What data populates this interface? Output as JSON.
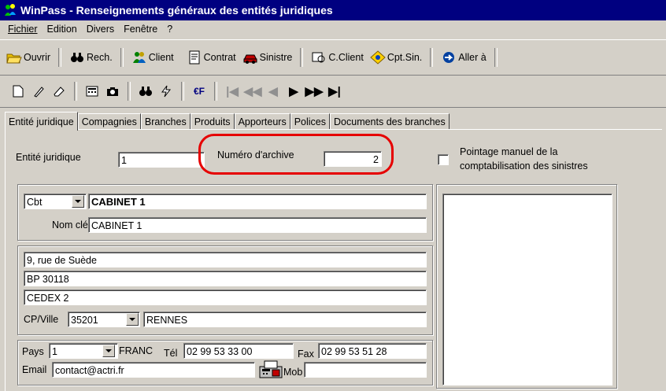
{
  "window": {
    "title": "WinPass - Renseignements généraux des entités juridiques",
    "app_icon": "winpass-people-icon"
  },
  "menu": {
    "items": [
      "Fichier",
      "Edition",
      "Divers",
      "Fenêtre",
      "?"
    ]
  },
  "toolbar1": {
    "open": "Ouvrir",
    "search": "Rech.",
    "client": "Client",
    "contract": "Contrat",
    "claim": "Sinistre",
    "client_account": "C.Client",
    "claim_account": "Cpt.Sin.",
    "goto": "Aller à"
  },
  "toolbar2": {
    "icons": [
      "new-document-icon",
      "edit-pencil-icon",
      "eraser-icon",
      "calculator-icon",
      "camera-icon",
      "binoculars-icon",
      "lightning-icon",
      "euro-franc-icon",
      "first-record-icon",
      "rewind-icon",
      "previous-icon",
      "next-icon",
      "fast-forward-icon",
      "last-record-icon"
    ],
    "euro_label": "€F"
  },
  "tabs": [
    "Entité juridique",
    "Compagnies",
    "Branches",
    "Produits",
    "Apporteurs",
    "Polices",
    "Documents des branches"
  ],
  "form": {
    "entity_label": "Entité juridique",
    "entity_value": "1",
    "archive_label": "Numéro d'archive",
    "archive_value": "2",
    "manual_label_1": "Pointage manuel de la",
    "manual_label_2": "comptabilisation des sinistres",
    "type_value": "Cbt",
    "name_value": "CABINET 1",
    "key_label": "Nom clé",
    "key_value": "CABINET 1",
    "address1": "9, rue de Suède",
    "address2": "BP 30118",
    "address3": "CEDEX 2",
    "cp_label": "CP/Ville",
    "cp_value": "35201",
    "city_value": "RENNES",
    "country_label": "Pays",
    "country_value": "1",
    "country_name": "FRANC",
    "tel_label": "Tél",
    "tel_value": "02 99 53 33 00",
    "fax_label": "Fax",
    "fax_value": "02 99 53 51 28",
    "email_label": "Email",
    "email_value": "contact@actri.fr",
    "mob_label": "Mob",
    "mob_value": ""
  },
  "colors": {
    "titlebar": "#000080",
    "highlight": "#e60000",
    "face": "#d4d0c8"
  }
}
